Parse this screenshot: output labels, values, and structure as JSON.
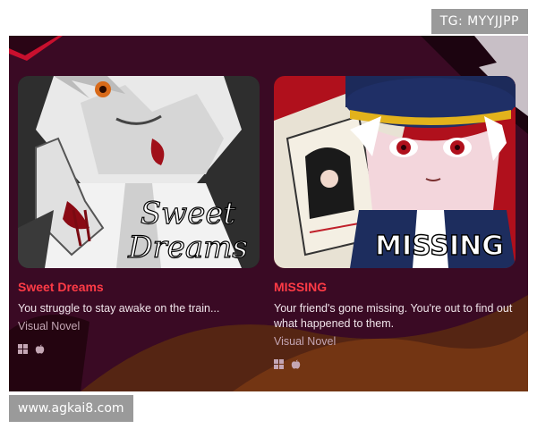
{
  "watermarks": {
    "top": "TG: MYYJJPP",
    "bottom": "www.agkai8.com"
  },
  "colors": {
    "panel_bg": "#3a0a24",
    "title_red": "#ff3b46",
    "desc_text": "#f0e4ea",
    "genre_text": "#c4a6b4"
  },
  "games": [
    {
      "title": "Sweet Dreams",
      "thumbnail_text_line1": "Sweet",
      "thumbnail_text_line2": "Dreams",
      "description": "You struggle to stay awake on the train...",
      "genre": "Visual Novel",
      "platforms": [
        "windows-icon",
        "apple-icon"
      ]
    },
    {
      "title": "MISSING",
      "thumbnail_text": "MISSING",
      "description": "Your friend's gone missing. You're out to find out what happened to them.",
      "genre": "Visual Novel",
      "platforms": [
        "windows-icon",
        "apple-icon"
      ]
    }
  ]
}
